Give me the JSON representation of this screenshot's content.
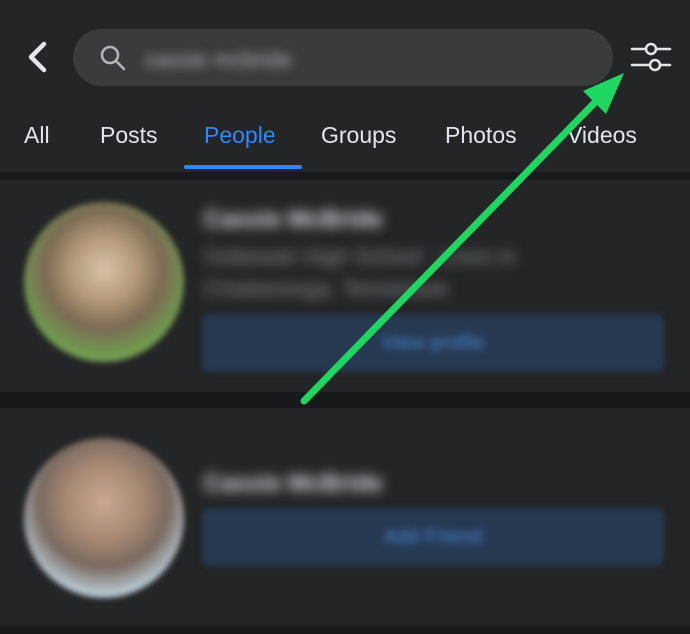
{
  "search": {
    "query": "cassie mcbride"
  },
  "tabs": [
    "All",
    "Posts",
    "People",
    "Groups",
    "Photos",
    "Videos"
  ],
  "active_tab": "People",
  "results": [
    {
      "name": "Cassie McBride",
      "subtitle_1": "Ooltewah High School · Lives in",
      "subtitle_2": "Chattanooga, Tennessee",
      "action": "View profile"
    },
    {
      "name": "Cassie McBride",
      "action": "Add Friend"
    }
  ],
  "colors": {
    "accent": "#2d88ff",
    "annotation_arrow": "#1ed760"
  },
  "icons": [
    "back-arrow-icon",
    "search-icon",
    "filter-sliders-icon"
  ]
}
